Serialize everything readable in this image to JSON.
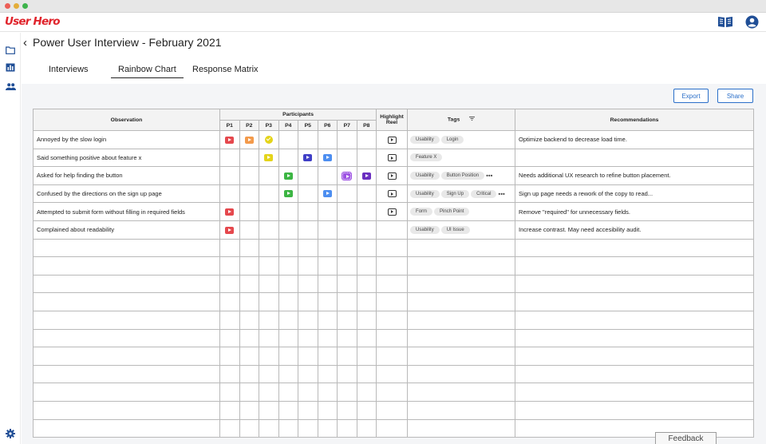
{
  "window": {
    "controls": [
      {
        "name": "close",
        "color": "#ec5f57"
      },
      {
        "name": "minimize",
        "color": "#e3ae3b"
      },
      {
        "name": "maximize",
        "color": "#3eb44c"
      }
    ]
  },
  "app": {
    "logo": "User Hero",
    "brand_color": "#e0242c",
    "accent_color": "#1f4e96"
  },
  "header": {
    "icons": [
      "book-icon",
      "account-icon"
    ]
  },
  "rail": {
    "icons": [
      "folder-icon",
      "chart-icon",
      "people-icon",
      "gear-icon"
    ]
  },
  "page": {
    "back_icon": "‹",
    "title": "Power User Interview - February 2021"
  },
  "tabs": [
    {
      "label": "Interviews",
      "active": false
    },
    {
      "label": "Rainbow Chart",
      "active": true
    },
    {
      "label": "Response Matrix",
      "active": false
    }
  ],
  "actions": {
    "export": "Export",
    "share": "Share"
  },
  "table": {
    "headers": {
      "observation": "Observation",
      "participants": "Participants",
      "highlight": [
        "Highlight",
        "Reel"
      ],
      "tags": "Tags",
      "recommendations": "Recommendations"
    },
    "participants": [
      "P1",
      "P2",
      "P3",
      "P4",
      "P5",
      "P6",
      "P7",
      "P8"
    ],
    "chip_colors": {
      "red": "#e5484d",
      "orange": "#f39a4b",
      "yellow": "#e4d41a",
      "green": "#3cb543",
      "indigo": "#3f3fc6",
      "blue": "#4d8ef0",
      "violet": "#9d52e3",
      "purple": "#6a2ec0"
    },
    "rows": [
      {
        "observation": "Annoyed by the slow login",
        "cells": [
          "red",
          "orange",
          "yellow-check",
          "",
          "",
          "",
          "",
          ""
        ],
        "highlight": true,
        "tags": [
          "Usability",
          "Login"
        ],
        "more": "",
        "recommendation": "Optimize backend to decrease load time."
      },
      {
        "observation": "Said something positive about feature x",
        "cells": [
          "",
          "",
          "yellow",
          "",
          "indigo",
          "blue",
          "",
          ""
        ],
        "highlight": true,
        "tags": [
          "Feature X"
        ],
        "more": "",
        "recommendation": ""
      },
      {
        "observation": "Asked for help finding the button",
        "cells": [
          "",
          "",
          "",
          "green",
          "",
          "",
          "violet-grid",
          "purple"
        ],
        "highlight": true,
        "tags": [
          "Usability",
          "Button Position"
        ],
        "more": "•••",
        "recommendation": "Needs additional UX research to refine button placement."
      },
      {
        "observation": "Confused by the directions on the sign up page",
        "cells": [
          "",
          "",
          "",
          "green",
          "",
          "blue",
          "",
          ""
        ],
        "highlight": true,
        "tags": [
          "Usability",
          "Sign Up",
          "Critical"
        ],
        "more": "•••",
        "recommendation": "Sign up page needs a rework of the copy to read..."
      },
      {
        "observation": "Attempted to submit form without filling in required fields",
        "cells": [
          "red",
          "",
          "",
          "",
          "",
          "",
          "",
          ""
        ],
        "highlight": true,
        "tags": [
          "Form",
          "Pinch Point"
        ],
        "more": "",
        "recommendation": "Remove \"required\" for unnecessary fields."
      },
      {
        "observation": "Complained about readability",
        "cells": [
          "red",
          "",
          "",
          "",
          "",
          "",
          "",
          ""
        ],
        "highlight": false,
        "tags": [
          "Usability",
          "UI Issue"
        ],
        "more": "",
        "recommendation": "Increase contrast. May need accesibility audit."
      }
    ],
    "empty_rows": 11
  },
  "feedback": "Feedback"
}
